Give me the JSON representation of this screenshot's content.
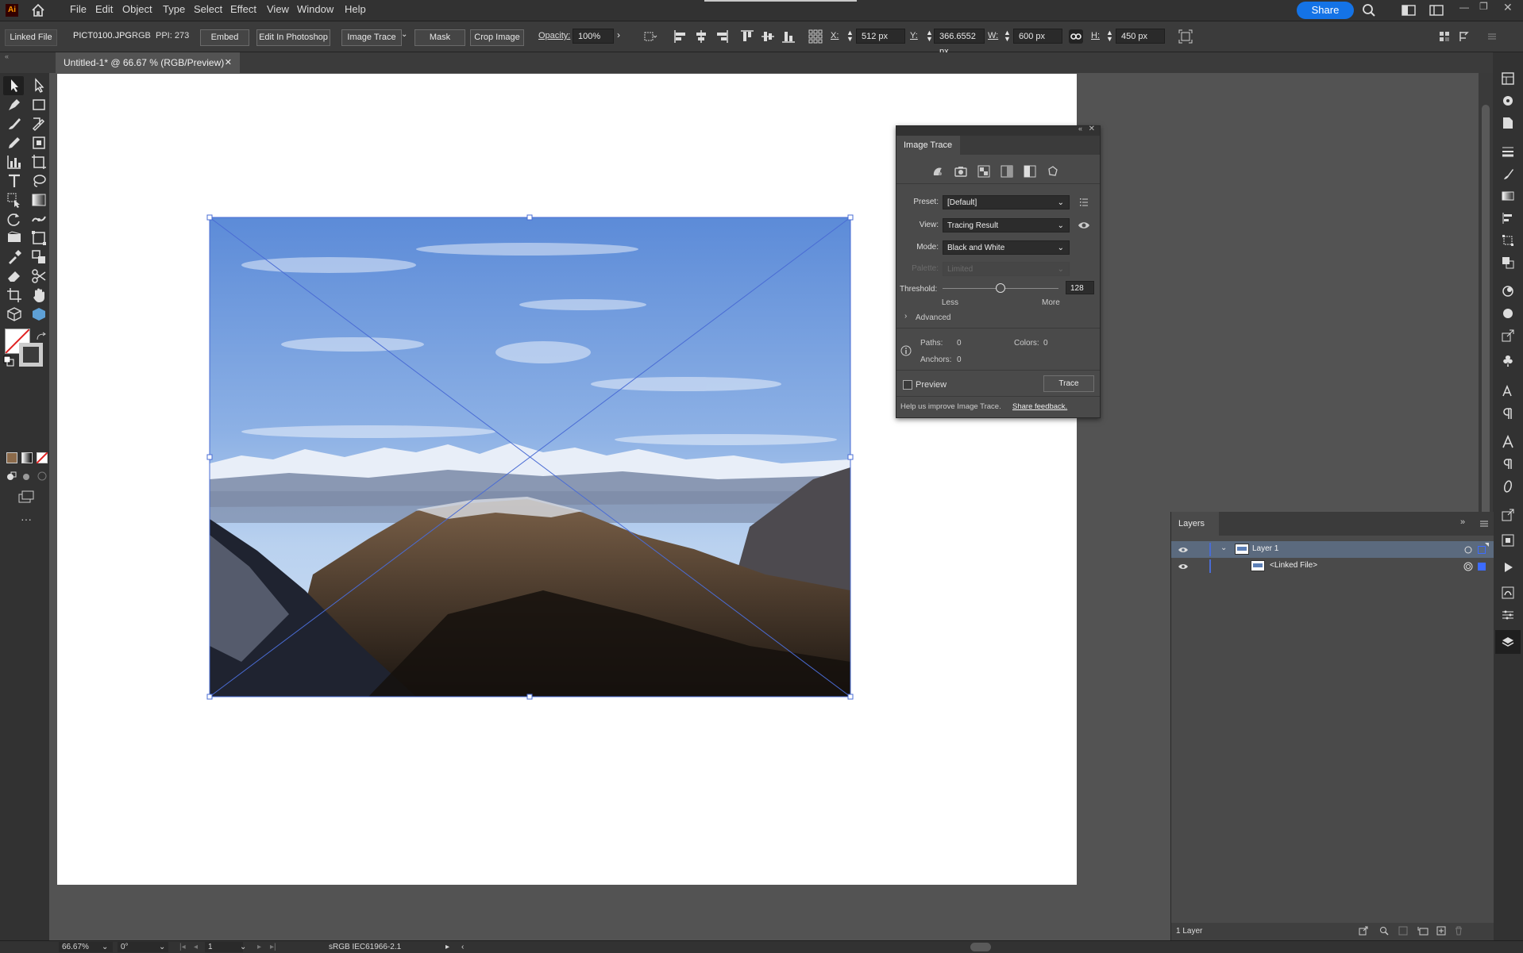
{
  "app": {
    "logo": "Ai",
    "colors": {
      "accent": "#1473e6",
      "selection": "#4a6cd4",
      "layer_highlight": "#5b6a7e"
    }
  },
  "menu": [
    "File",
    "Edit",
    "Object",
    "Type",
    "Select",
    "Effect",
    "View",
    "Window",
    "Help"
  ],
  "header": {
    "share_label": "Share",
    "icons": [
      "home-icon",
      "search-icon",
      "arrange-docs-icon",
      "workspace-icon"
    ]
  },
  "control_bar": {
    "linked_file_label": "Linked File",
    "filename": "PICT0100.JPG",
    "color_mode": "RGB",
    "ppi": "PPI: 273",
    "embed": "Embed",
    "edit_in_photoshop": "Edit In Photoshop",
    "image_trace": "Image Trace",
    "mask": "Mask",
    "crop_image": "Crop Image",
    "opacity_label": "Opacity:",
    "opacity_value": "100%",
    "x_label": "X:",
    "x_value": "512 px",
    "y_label": "Y:",
    "y_value": "366.6552 px",
    "w_label": "W:",
    "w_value": "600 px",
    "h_label": "H:",
    "h_value": "450 px"
  },
  "document": {
    "tab_title": "Untitled-1* @ 66.67 % (RGB/Preview)"
  },
  "image_trace": {
    "title": "Image Trace",
    "preset_label": "Preset:",
    "preset_value": "[Default]",
    "view_label": "View:",
    "view_value": "Tracing Result",
    "mode_label": "Mode:",
    "mode_value": "Black and White",
    "palette_label": "Palette:",
    "palette_value": "Limited",
    "threshold_label": "Threshold:",
    "threshold_value": "128",
    "threshold_fraction": 0.5,
    "less": "Less",
    "more": "More",
    "advanced": "Advanced",
    "paths_label": "Paths:",
    "paths_value": "0",
    "colors_label": "Colors:",
    "colors_value": "0",
    "anchors_label": "Anchors:",
    "anchors_value": "0",
    "preview_label": "Preview",
    "trace_button": "Trace",
    "help_text": "Help us improve Image Trace.",
    "feedback_link": "Share feedback."
  },
  "layers": {
    "title": "Layers",
    "items": [
      {
        "name": "Layer 1",
        "level": 0
      },
      {
        "name": "<Linked File>",
        "level": 1
      }
    ],
    "footer_count": "1 Layer"
  },
  "status_bar": {
    "zoom": "66.67%",
    "rotation": "0°",
    "artboard_number": "1",
    "color_profile": "sRGB IEC61966-2.1"
  }
}
